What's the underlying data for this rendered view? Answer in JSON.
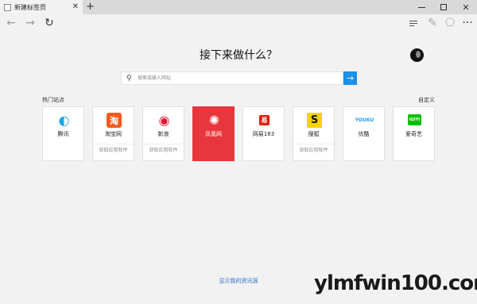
{
  "tab": {
    "title": "新建标签页",
    "close": "✕",
    "new": "+"
  },
  "window_controls": {
    "close": "✕"
  },
  "toolbar": {
    "back": "←",
    "forward": "→",
    "refresh": "↻",
    "note": "✎",
    "share": "⎔",
    "more": "···"
  },
  "page": {
    "heading": "接下来做什么？",
    "search_placeholder": "搜索或输入网址",
    "search_go": "→",
    "sites_label": "热门站点",
    "customize_label": "自定义",
    "news_link": "显示我的资讯源"
  },
  "tiles": [
    {
      "name": "腾讯",
      "icon": "tencent-icon",
      "glyph": "◐",
      "color": "#1ea6e6",
      "sub": ""
    },
    {
      "name": "淘宝网",
      "icon": "taobao-icon",
      "glyph": "淘",
      "color": "#f55a1d",
      "sub": "获取应用软件"
    },
    {
      "name": "新浪",
      "icon": "weibo-icon",
      "glyph": "◉",
      "color": "#e6162d",
      "sub": "获取应用软件"
    },
    {
      "name": "凤凰网",
      "icon": "phoenix-icon",
      "glyph": "✺",
      "color": "#e8363d",
      "sub": ""
    },
    {
      "name": "网易163",
      "icon": "netease-icon",
      "glyph": "易",
      "color": "#d81e06",
      "sub": ""
    },
    {
      "name": "搜狐",
      "icon": "sohu-icon",
      "glyph": "S",
      "color": "#f5d400",
      "sub": "获取应用软件"
    },
    {
      "name": "优酷",
      "icon": "youku-icon",
      "glyph": "YOUKU",
      "color": "#1f9be8",
      "sub": ""
    },
    {
      "name": "爱奇艺",
      "icon": "iqiyi-icon",
      "glyph": "iQIYI",
      "color": "#00be06",
      "sub": ""
    }
  ],
  "watermark": "ylmfwin100.com"
}
